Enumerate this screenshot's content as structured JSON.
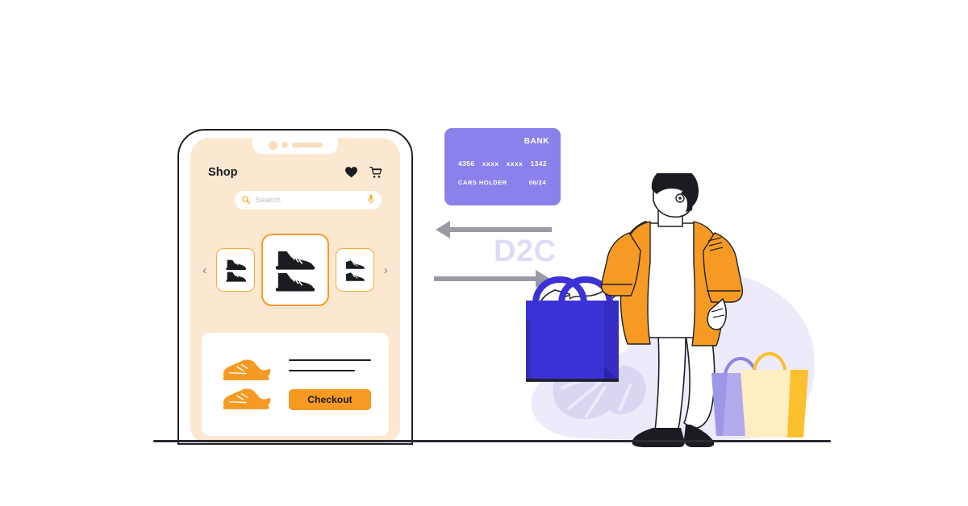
{
  "scene": {
    "title": "D2C ecommerce illustration",
    "concept_label": "D2C",
    "colors": {
      "orange": "#f79a23",
      "peach_screen": "#fce8d0",
      "purple_card": "#8a81ea",
      "blue_bag": "#3b32d6",
      "lavender_blob": "#ecebfb",
      "lavender_text": "#dcdcf7",
      "arrow_gray": "#9a9aa4",
      "dark": "#1f1f25",
      "bag_lavender": "#b2abee",
      "bag_cream": "#fdeec4",
      "bag_yellow": "#fbc02d"
    }
  },
  "phone": {
    "app": {
      "title": "Shop",
      "header_icons": [
        {
          "name": "heart-icon",
          "label": "Favorites"
        },
        {
          "name": "cart-icon",
          "label": "Cart"
        }
      ],
      "search": {
        "placeholder": "Search",
        "left_icon": "search-icon",
        "right_icon": "microphone-icon"
      },
      "carousel": {
        "prev_label": "‹",
        "next_label": "›",
        "items": [
          {
            "name": "shoe-card-left",
            "icon": "sneaker-pair-icon",
            "selected": false
          },
          {
            "name": "shoe-card-center",
            "icon": "sneaker-pair-icon",
            "selected": true
          },
          {
            "name": "shoe-card-right",
            "icon": "sneaker-pair-icon",
            "selected": false
          }
        ]
      },
      "checkout_panel": {
        "product_icon": "orange-sneaker-pair-icon",
        "placeholder_lines": 2,
        "button_label": "Checkout"
      }
    }
  },
  "bank_card": {
    "bank_label": "BANK",
    "number_groups": [
      "4356",
      "xxxx",
      "xxxx",
      "1342"
    ],
    "holder_label": "CARS HOLDER",
    "expiry": "06/24"
  },
  "arrows": [
    {
      "name": "arrow-left",
      "direction": "left",
      "color": "#9a9aa4"
    },
    {
      "name": "arrow-right",
      "direction": "right",
      "color": "#9a9aa4"
    }
  ],
  "character": {
    "description": "Man carrying shopping bag",
    "hair_color": "#1b1b22",
    "jacket_color": "#f79a23",
    "shirt_color": "#ffffff",
    "pants_color": "#ffffff",
    "shoes_color": "#1b1b22"
  },
  "bags": [
    {
      "name": "shopping-bag-blue",
      "color": "#3b32d6"
    },
    {
      "name": "shopping-bag-lavender",
      "color": "#b2abee"
    },
    {
      "name": "shopping-bag-cream",
      "color": "#fdeec4"
    }
  ]
}
